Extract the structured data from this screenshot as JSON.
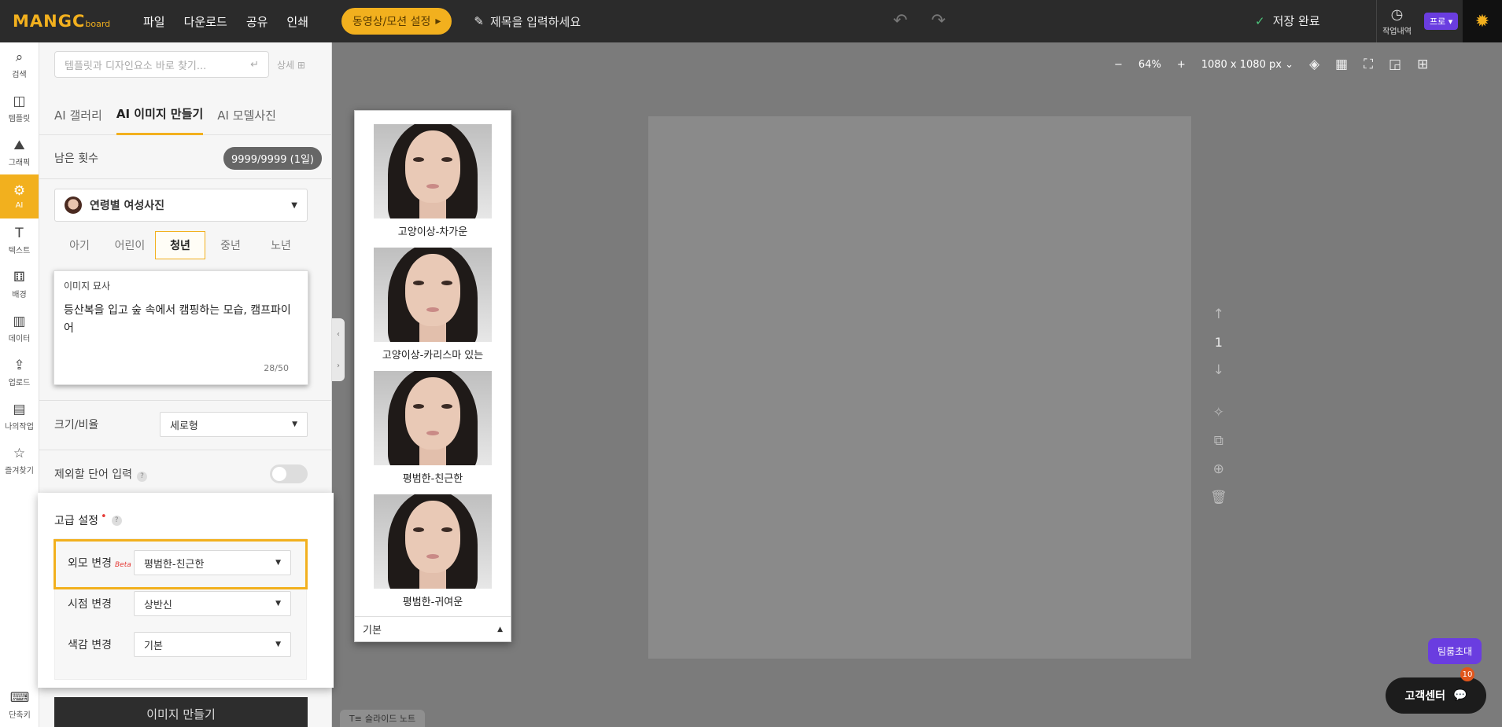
{
  "topbar": {
    "logo": "MANGC",
    "logo_sub": "board",
    "menu": [
      "파일",
      "다운로드",
      "공유",
      "인쇄"
    ],
    "motion_button": "동영상/모션 설정",
    "title_placeholder": "제목을 입력하세요",
    "save_status": "저장 완료",
    "history_label": "작업내역",
    "pro_label": "프로"
  },
  "rail": [
    {
      "label": "검색",
      "icon": "search-icon"
    },
    {
      "label": "템플릿",
      "icon": "template-icon"
    },
    {
      "label": "그래픽",
      "icon": "graphic-icon"
    },
    {
      "label": "AI",
      "icon": "ai-icon",
      "active": true
    },
    {
      "label": "텍스트",
      "icon": "text-icon"
    },
    {
      "label": "배경",
      "icon": "background-icon"
    },
    {
      "label": "데이터",
      "icon": "chart-icon"
    },
    {
      "label": "업로드",
      "icon": "upload-icon"
    },
    {
      "label": "나의작업",
      "icon": "folder-icon"
    },
    {
      "label": "즐겨찾기",
      "icon": "star-icon"
    }
  ],
  "rail_bottom": {
    "label": "단축키",
    "icon": "keyboard-icon"
  },
  "panel": {
    "search_placeholder": "템플릿과 디자인요소 바로 찾기...",
    "detail_link": "상세",
    "tabs": [
      "AI 갤러리",
      "AI 이미지 만들기",
      "AI 모델사진"
    ],
    "active_tab": 1,
    "remaining_label": "남은 횟수",
    "remaining_value": "9999/9999 (1일)",
    "category": "연령별 여성사진",
    "ages": [
      "아기",
      "어린이",
      "청년",
      "중년",
      "노년"
    ],
    "active_age": 2,
    "desc_header": "이미지 묘사",
    "desc_text": "등산복을 입고 숲 속에서 캠핑하는 모습, 캠프파이어",
    "desc_count": "28/50",
    "size_label": "크기/비율",
    "size_value": "세로형",
    "exclude_label": "제외할 단어 입력",
    "make_button": "이미지 만들기"
  },
  "advanced": {
    "title": "고급 설정",
    "rows": [
      {
        "label": "외모 변경",
        "beta": "Beta",
        "value": "평범한-친근한"
      },
      {
        "label": "시점 변경",
        "value": "상반신"
      },
      {
        "label": "색감 변경",
        "value": "기본"
      }
    ]
  },
  "face_list": {
    "items": [
      "고양이상-차가운",
      "고양이상-카리스마 있는",
      "평범한-친근한",
      "평범한-귀여운"
    ],
    "footer": "기본"
  },
  "canvas": {
    "zoom": "64%",
    "size": "1080 x 1080 px",
    "page_number": "1",
    "slide_note": "슬라이드 노트"
  },
  "float": {
    "team_invite": "팀룸초대",
    "support": "고객센터",
    "support_badge": "10"
  }
}
